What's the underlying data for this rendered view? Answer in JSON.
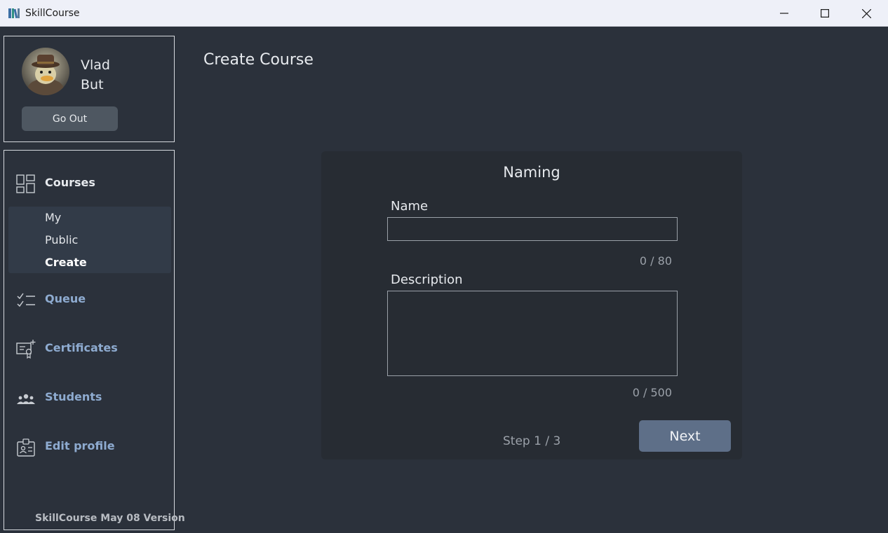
{
  "window": {
    "title": "SkillCourse",
    "icon": "books-icon",
    "controls": [
      "minimize-icon",
      "maximize-icon",
      "close-icon"
    ]
  },
  "profile": {
    "first_name": "Vlad",
    "last_name": "But",
    "go_out_label": "Go Out"
  },
  "nav": {
    "courses": "Courses",
    "sub_items": [
      "My",
      "Public",
      "Create"
    ],
    "queue": "Queue",
    "certificates": "Certificates",
    "students": "Students",
    "edit_profile": "Edit profile"
  },
  "footer": {
    "version": "SkillCourse  May 08 Version"
  },
  "main": {
    "page_title": "Create Course",
    "card_title": "Naming",
    "name_label": "Name",
    "name_value": "",
    "name_counter": "0 / 80",
    "description_label": "Description",
    "description_value": "",
    "description_counter": "0 / 500",
    "step": "Step 1 / 3",
    "next_label": "Next"
  },
  "colors": {
    "background": "#2b313b",
    "card": "#272c33",
    "accent_link": "#8eabd0",
    "next_button": "#5e6f88"
  }
}
